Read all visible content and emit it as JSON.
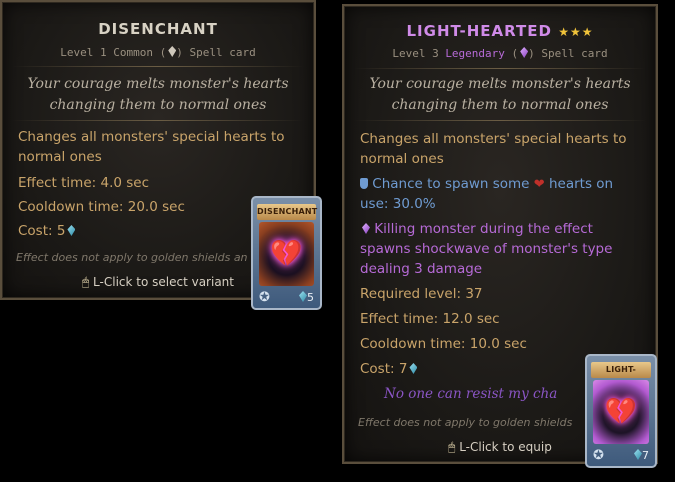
{
  "left": {
    "title": "DISENCHANT",
    "subtitle": {
      "prefix": "Level 1 Common (",
      "suffix": ") Spell card"
    },
    "flavor": [
      "Your courage melts monster's hearts",
      "changing them to normal ones"
    ],
    "lines": {
      "effect1": "Changes all monsters' special hearts to",
      "effect2": "normal ones",
      "effect_time": "Effect time: 4.0 sec",
      "cooldown": "Cooldown time: 20.0 sec",
      "cost": "Cost: 5"
    },
    "note": "Effect does not apply to golden shields an",
    "hint": "L-Click to select variant",
    "card": {
      "name": "DISENCHANT",
      "cost": "5"
    }
  },
  "right": {
    "title": "LIGHT-HEARTED",
    "stars": "★★★",
    "subtitle": {
      "prefix": "Level 3 ",
      "rarity": "Legendary",
      "paren_open": " (",
      "suffix": ") Spell card"
    },
    "flavor": [
      "Your courage melts monster's hearts",
      "changing them to normal ones"
    ],
    "lines": {
      "effect1": "Changes all monsters' special hearts to",
      "effect2": "normal ones",
      "chance1_a": "Chance to spawn some ",
      "chance1_b": " hearts on",
      "chance2": "use: 30.0%",
      "kill1": "Killing monster during the effect",
      "kill2": "spawns shockwave of monster's type",
      "kill3": "dealing 3 damage",
      "req_level": "Required level: 37",
      "effect_time": "Effect time: 12.0 sec",
      "cooldown": "Cooldown time: 10.0 sec",
      "cost": "Cost: 7"
    },
    "quote": "No one can resist my cha",
    "note": "Effect does not apply to golden shields",
    "hint": "L-Click to equip",
    "card": {
      "name": "LIGHT-HEARTED",
      "cost": "7"
    }
  },
  "colors": {
    "gold": "#c9a46a",
    "blue": "#6f9bd1",
    "purple": "#b66ad6",
    "title_legendary": "#d08be8"
  }
}
